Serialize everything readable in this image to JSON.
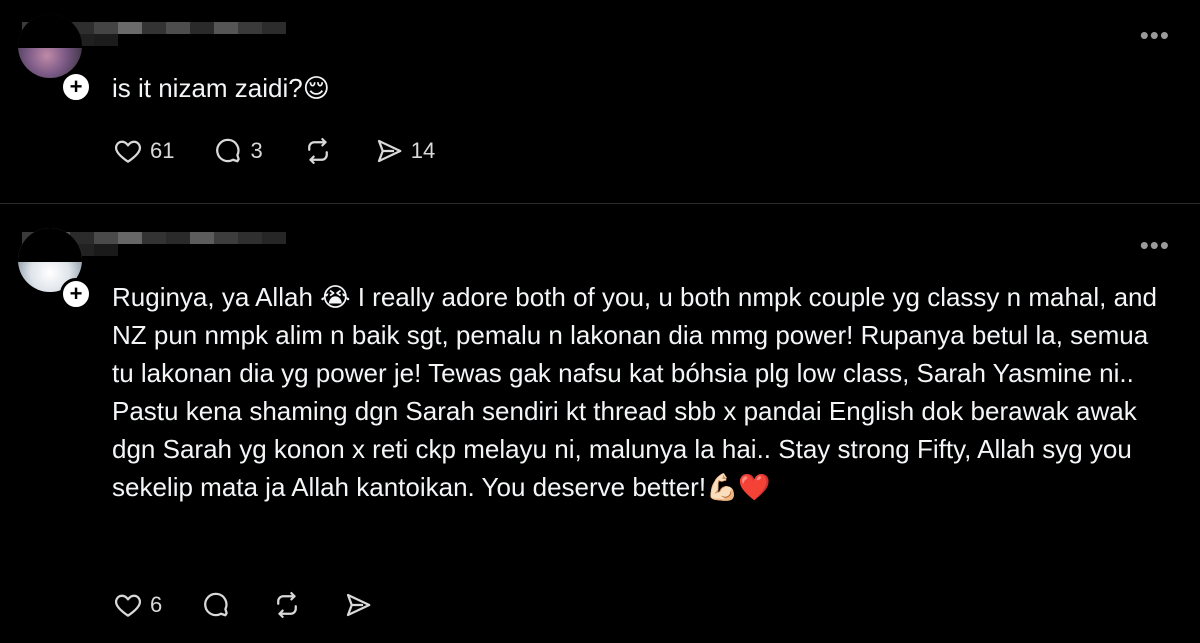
{
  "posts": [
    {
      "text": "is it nizam zaidi?😌",
      "more_label": "•••",
      "plus_label": "+",
      "actions": {
        "likes": "61",
        "comments": "3",
        "shares": "14"
      }
    },
    {
      "text": "Ruginya, ya Allah 😭 I really adore both of you, u both nmpk couple yg classy n mahal, and NZ pun nmpk alim n baik sgt, pemalu n lakonan dia mmg power! Rupanya betul la, semua tu lakonan dia yg power je! Tewas gak nafsu kat bóhsia plg low class, Sarah Yasmine ni.. Pastu kena shaming dgn Sarah sendiri kt thread sbb x pandai English dok berawak awak dgn Sarah yg konon x reti ckp melayu ni, malunya la hai.. Stay strong Fifty, Allah syg you sekelip mata ja Allah kantoikan. You deserve better!💪🏻❤️",
      "more_label": "•••",
      "plus_label": "+",
      "actions": {
        "likes": "6"
      }
    }
  ],
  "colors": {
    "background": "#000000",
    "text": "#f3f5f7",
    "icon": "#d9d9d9",
    "divider": "#2a2a2a"
  },
  "icons": [
    "heart-icon",
    "comment-icon",
    "repost-icon",
    "share-icon",
    "more-icon",
    "plus-icon"
  ]
}
